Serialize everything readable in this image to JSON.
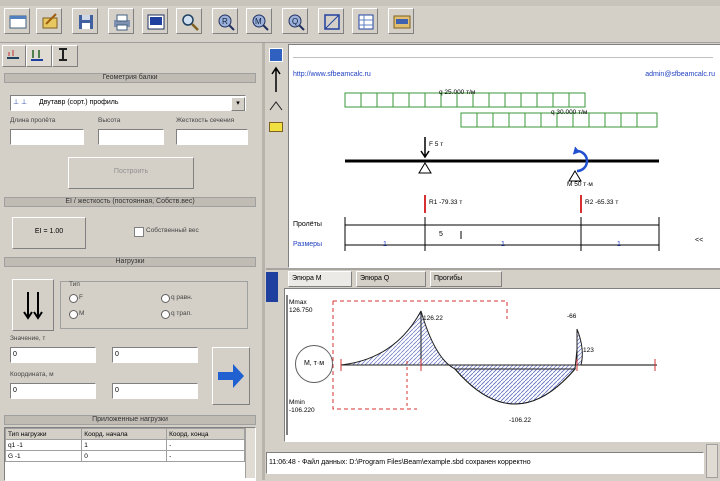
{
  "toolbar": {
    "buttons": [
      "new-file-icon",
      "open-file-icon",
      "save-icon",
      "print-icon",
      "export-icon",
      "zoom-icon",
      "reaction-R-icon",
      "moment-M-icon",
      "shear-Q-icon",
      "frame-icon",
      "grid-icon",
      "image-icon"
    ]
  },
  "left_tabs": [
    "beam-icon",
    "load-icon",
    "section-icon"
  ],
  "geometry": {
    "header": "Геометрия балки",
    "section_select": "Двутавр (сорт.) профиль",
    "labels": [
      "Длина пролёта",
      "Высота",
      "Жесткость сечения"
    ],
    "button": "Построить"
  },
  "ei": {
    "header": "EI / жесткость (постоянная, Собств.вес)",
    "button": "EI = 1.00",
    "checkbox_label": "Собственный вес"
  },
  "loads": {
    "header": "Нагрузки",
    "group_label": "Тип",
    "radio": [
      "F",
      "M",
      "q равн.",
      "q трап."
    ],
    "label_value": "Значение, т",
    "label_coord": "Координата, м",
    "values": [
      "0",
      "0",
      "0",
      "0"
    ]
  },
  "applied": {
    "header": "Приложенные нагрузки",
    "columns": [
      "Тип нагрузки",
      "Коорд. начала",
      "Коорд. конца"
    ],
    "rows": [
      [
        "q1 -1",
        "1",
        "-"
      ],
      [
        "G -1",
        "0",
        "-"
      ]
    ]
  },
  "diagram": {
    "url": "http://www.sfbeamcalc.ru",
    "email": "admin@sfbeamcalc.ru",
    "load_labels": [
      "q 25.000 т/м",
      "q 30.000 т/м",
      "F 5 т",
      "M 50 т·м"
    ],
    "reactions": [
      "R1 -79.33 т",
      "R2 -65.33 т"
    ],
    "row_labels": [
      "Пролёты",
      "Размеры"
    ],
    "dims": [
      "1",
      "1",
      "5",
      "1",
      "1"
    ],
    "dim_arrow": "<<"
  },
  "bottom_tabs": [
    "Эпюра M",
    "Эпюра Q",
    "Прогибы"
  ],
  "plot": {
    "axis_top": "Mmax 126.750",
    "axis_bottom": "Mmin -106.220",
    "values": [
      "126.22",
      "-66",
      "123",
      "-106.22"
    ],
    "badge": "M, т·м"
  },
  "status": "11:06:48 - Файл данных: D:\\Program Files\\Beam\\example.sbd сохранен корректно",
  "colors": {
    "green": "#3a9a3a",
    "red": "#d63030",
    "blue": "#2050d0",
    "hatch": "#7080c8"
  }
}
